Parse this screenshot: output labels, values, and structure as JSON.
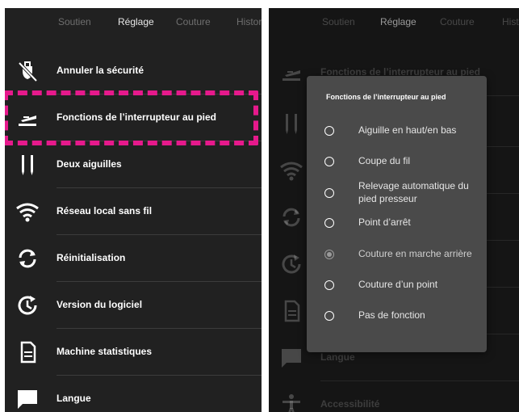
{
  "tabs": [
    "Soutien",
    "Réglage",
    "Couture",
    "Historique"
  ],
  "tabs_right": [
    "Soutien",
    "Réglage",
    "Couture",
    "Histo"
  ],
  "active_tab": "Réglage",
  "menu_items": [
    {
      "label": "Annuler la sécurité",
      "icon": "lock-off-icon"
    },
    {
      "label": "Fonctions de l’interrupteur au pied",
      "icon": "foot-switch-icon"
    },
    {
      "label": "Deux aiguilles",
      "icon": "twin-needle-icon"
    },
    {
      "label": "Réseau local sans fil",
      "icon": "wifi-icon"
    },
    {
      "label": "Réinitialisation",
      "icon": "reset-icon"
    },
    {
      "label": "Version du logiciel",
      "icon": "software-version-icon"
    },
    {
      "label": "Machine statistiques",
      "icon": "document-icon"
    },
    {
      "label": "Langue",
      "icon": "chat-icon"
    }
  ],
  "right_menu_items": [
    {
      "label": "Fonctions de l’interrupteur au pied",
      "icon": "foot-switch-icon"
    },
    {
      "label": "",
      "icon": "twin-needle-icon"
    },
    {
      "label": "",
      "icon": "wifi-icon"
    },
    {
      "label": "",
      "icon": "reset-icon"
    },
    {
      "label": "",
      "icon": "software-version-icon"
    },
    {
      "label": "",
      "icon": "document-icon"
    },
    {
      "label": "Langue",
      "icon": "chat-icon"
    },
    {
      "label": "Accessibilité",
      "icon": "accessibility-icon"
    }
  ],
  "dialog": {
    "title": "Fonctions de l’interrupteur au pied",
    "options": [
      {
        "label": "Aiguille en haut/en bas",
        "selected": false
      },
      {
        "label": "Coupe du fil",
        "selected": false
      },
      {
        "label": "Relevage automatique du pied presseur",
        "selected": false
      },
      {
        "label": "Point d’arrêt",
        "selected": false
      },
      {
        "label": "Couture en marche arrière",
        "selected": true
      },
      {
        "label": "Couture d’un point",
        "selected": false
      },
      {
        "label": "Pas de fonction",
        "selected": false
      }
    ]
  },
  "colors": {
    "background": "#212121",
    "highlight": "#e6198c",
    "dialog": "#4a4a4a",
    "text": "#ffffff"
  }
}
